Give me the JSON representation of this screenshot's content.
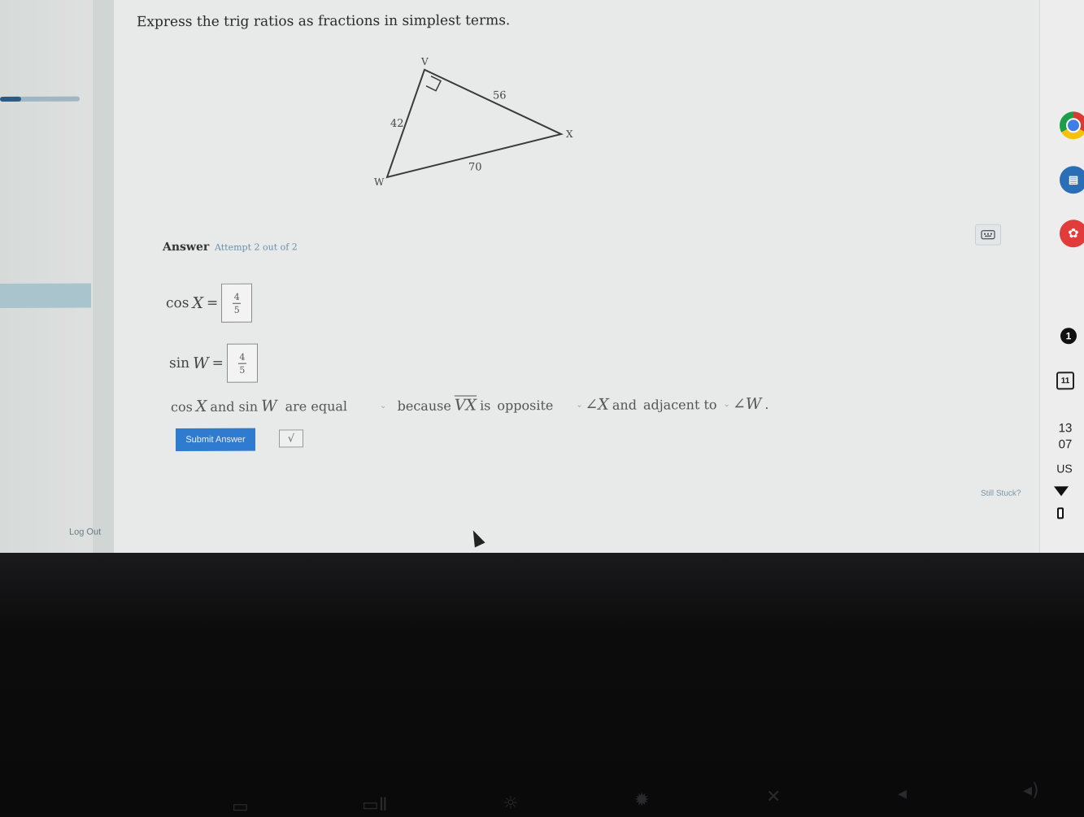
{
  "question": {
    "text": "Express the trig ratios as fractions in simplest terms."
  },
  "triangle": {
    "vertices": {
      "v": "V",
      "w": "W",
      "x": "X"
    },
    "sides": {
      "vw": "42",
      "vx": "56",
      "wx": "70"
    }
  },
  "answer": {
    "label": "Answer",
    "attempt": "Attempt 2 out of 2"
  },
  "equations": {
    "cos_fn": "cos",
    "cos_var": "X",
    "cos_num": "4",
    "cos_den": "5",
    "sin_fn": "sin",
    "sin_var": "W",
    "sin_num": "4",
    "sin_den": "5",
    "equals": "="
  },
  "sentence": {
    "cos_fn": "cos",
    "x_var": "X",
    "and": "and",
    "sin_fn": "sin",
    "w_var": "W",
    "relation_selected": "are equal",
    "because": "because",
    "segment": "VX",
    "is": "is",
    "opposite_selected": "opposite",
    "angle_x": "∠X",
    "and2": "and",
    "adjacent_selected": "adjacent to",
    "angle_w": "∠W",
    "period": "."
  },
  "buttons": {
    "submit": "Submit Answer",
    "sqrt": "√"
  },
  "links": {
    "still_stuck": "Still Stuck?",
    "logout": "Log Out"
  },
  "sidebar": {
    "progress_fraction": 0.27
  },
  "shelf": {
    "notification_count": "1",
    "calendar_day": "11",
    "time_hour": "13",
    "time_min": "07",
    "locale": "US"
  },
  "colors": {
    "submit_bg": "#2f7bd0",
    "progress_fill": "#2b5a84",
    "accent_link": "#6b8fae"
  }
}
